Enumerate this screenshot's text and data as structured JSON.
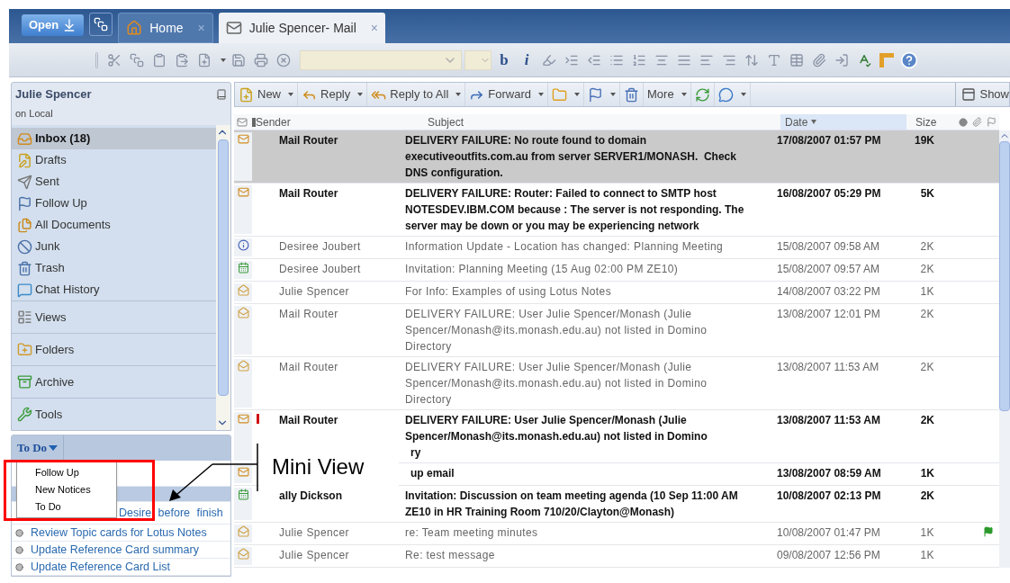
{
  "open_button": "Open",
  "tabs": [
    {
      "label": "Home",
      "kind": "home",
      "selected": false,
      "close": "×"
    },
    {
      "label": "Julie Spencer- Mail",
      "kind": "mail",
      "selected": true,
      "close": "×"
    }
  ],
  "format_toolbar": {
    "bold": "b",
    "italic": "i"
  },
  "nav": {
    "title": "Julie Spencer",
    "subtitle": "on Local",
    "folders": [
      {
        "label": "Inbox (18)",
        "selected": true
      },
      {
        "label": "Drafts",
        "selected": false
      },
      {
        "label": "Sent",
        "selected": false
      },
      {
        "label": "Follow Up",
        "selected": false
      },
      {
        "label": "All Documents",
        "selected": false
      },
      {
        "label": "Junk",
        "selected": false
      },
      {
        "label": "Trash",
        "selected": false
      },
      {
        "label": "Chat History",
        "selected": false
      }
    ],
    "sections": [
      {
        "label": "Views"
      },
      {
        "label": "Folders"
      },
      {
        "label": "Archive"
      },
      {
        "label": "Tools"
      }
    ]
  },
  "todo": {
    "title": "To Do",
    "menu": [
      "Follow Up",
      "New Notices",
      "To Do"
    ],
    "items": [
      {
        "selected": false
      },
      {
        "selected": true
      },
      {
        "label": "Desire before finish",
        "selected": false
      },
      {
        "label": "Review Topic cards for Lotus Notes",
        "selected": false
      },
      {
        "label": "Update Reference Card summary",
        "selected": false
      },
      {
        "label": "Update Reference Card List",
        "selected": false
      }
    ]
  },
  "annotation": {
    "label": "Mini View"
  },
  "actions": [
    {
      "kind": "new",
      "label": "New"
    },
    {
      "kind": "reply",
      "label": "Reply"
    },
    {
      "kind": "replyall",
      "label": "Reply to All"
    },
    {
      "kind": "forward",
      "label": "Forward"
    },
    {
      "kind": "folder"
    },
    {
      "kind": "flag"
    },
    {
      "kind": "trash"
    },
    {
      "kind": "more",
      "label": "More"
    },
    {
      "kind": "refresh"
    },
    {
      "kind": "chat"
    }
  ],
  "show_button": "Show",
  "columns": [
    {
      "label": "Sender",
      "sorted": false
    },
    {
      "label": "Subject",
      "sorted": false
    },
    {
      "label": "Date",
      "sorted": true
    },
    {
      "label": "Size",
      "sorted": false
    }
  ],
  "rows": [
    {
      "kind": "mail",
      "unread": true,
      "selected": true,
      "important": false,
      "flagged": false,
      "sender": "Mail Router",
      "subject": "DELIVERY FAILURE: No route found to domain executiveoutfits.com.au from server SERVER1/MONASH.  Check DNS configuration.",
      "date": "17/08/2007 01:57 PM",
      "size": "19K"
    },
    {
      "kind": "mail",
      "unread": true,
      "selected": false,
      "important": false,
      "flagged": false,
      "sender": "Mail Router",
      "subject": "DELIVERY FAILURE: Router: Failed to connect to SMTP host NOTESDEV.IBM.COM because : The server is not responding. The server may be down or you may be experiencing network",
      "date": "16/08/2007 05:29 PM",
      "size": "5K"
    },
    {
      "kind": "info",
      "unread": false,
      "selected": false,
      "important": false,
      "flagged": false,
      "sender": "Desiree Joubert",
      "subject": "Information Update - Location has changed: Planning Meeting",
      "date": "15/08/2007 09:58 AM",
      "size": "2K"
    },
    {
      "kind": "invite",
      "unread": false,
      "selected": false,
      "important": false,
      "flagged": false,
      "sender": "Desiree Joubert",
      "subject": "Invitation: Planning Meeting (15 Aug 02:00 PM ZE10)",
      "date": "15/08/2007 09:57 AM",
      "size": "2K"
    },
    {
      "kind": "read",
      "unread": false,
      "selected": false,
      "important": false,
      "flagged": false,
      "sender": "Julie Spencer",
      "subject": "For Info: Examples of using Lotus Notes",
      "date": "14/08/2007 03:22 PM",
      "size": "1K"
    },
    {
      "kind": "read",
      "unread": false,
      "selected": false,
      "important": false,
      "flagged": false,
      "sender": "Mail Router",
      "subject": "DELIVERY FAILURE: User Julie Spencer/Monash (Julie Spencer/Monash@its.monash.edu.au) not listed in Domino Directory",
      "date": "13/08/2007 12:01 PM",
      "size": "2K"
    },
    {
      "kind": "read",
      "unread": false,
      "selected": false,
      "important": false,
      "flagged": false,
      "sender": "Mail Router",
      "subject": "DELIVERY FAILURE: User Julie Spencer/Monash (Julie Spencer/Monash@its.monash.edu.au) not listed in Domino Directory",
      "date": "13/08/2007 11:53 AM",
      "size": "2K"
    },
    {
      "kind": "mail",
      "unread": true,
      "selected": false,
      "important": true,
      "flagged": false,
      "sender": "Mail Router",
      "subject": "DELIVERY FAILURE: User Julie Spencer/Monash (Julie Spencer/Monash@its.monash.edu.au) not listed in Domino",
      "subject_tail": "ry",
      "date": "13/08/2007 11:53 AM",
      "size": "2K"
    },
    {
      "kind": "mail",
      "unread": true,
      "selected": false,
      "important": false,
      "flagged": false,
      "subject_tail": "up email",
      "date": "13/08/2007 08:59 AM",
      "size": "1K"
    },
    {
      "kind": "invite",
      "unread": true,
      "selected": false,
      "important": false,
      "flagged": false,
      "sender": "ally Dickson",
      "subject": "Invitation: Discussion on team meeting agenda (10 Sep 11:00 AM ZE10 in HR Training Room 710/20/Clayton@Monash)",
      "date": "10/08/2007 02:13 PM",
      "size": "2K"
    },
    {
      "kind": "read",
      "unread": false,
      "selected": false,
      "important": false,
      "flagged": true,
      "sender": "Julie Spencer",
      "subject": "re: Team meeting minutes",
      "date": "10/08/2007 01:47 PM",
      "size": "1K"
    },
    {
      "kind": "read",
      "unread": false,
      "selected": false,
      "important": false,
      "flagged": false,
      "sender": "Julie Spencer",
      "subject": "Re: test message",
      "date": "09/08/2007 12:56 PM",
      "size": "1K"
    }
  ]
}
